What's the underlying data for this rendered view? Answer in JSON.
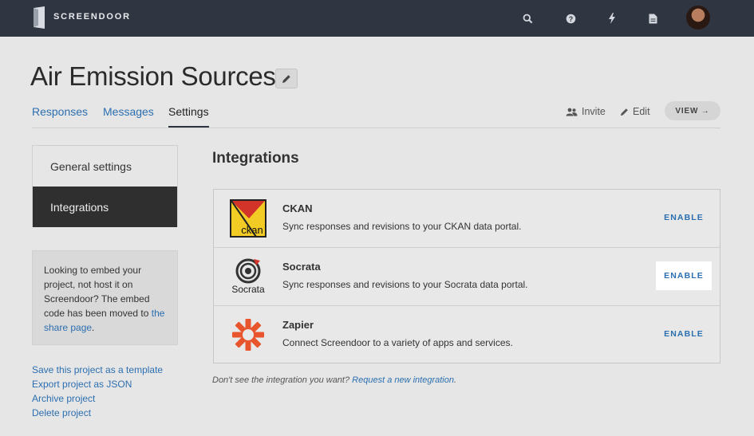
{
  "app": {
    "brand": "SCREENDOOR"
  },
  "topbar": {
    "icons": [
      "search-icon",
      "help-icon",
      "bolt-icon",
      "document-icon"
    ]
  },
  "page": {
    "title": "Air Emission Sources"
  },
  "tabs": [
    {
      "label": "Responses",
      "active": false
    },
    {
      "label": "Messages",
      "active": false
    },
    {
      "label": "Settings",
      "active": true
    }
  ],
  "actions": {
    "invite": "Invite",
    "edit": "Edit",
    "view": "VIEW →"
  },
  "sidebar": {
    "items": [
      {
        "label": "General settings",
        "active": false
      },
      {
        "label": "Integrations",
        "active": true
      }
    ],
    "embed_text": "Looking to embed your project, not host it on Screendoor? The embed code has been moved to",
    "embed_link": "the share page",
    "embed_end": ".",
    "links": [
      "Save this project as a template",
      "Export project as JSON",
      "Archive project",
      "Delete project"
    ]
  },
  "main": {
    "section_title": "Integrations",
    "integrations": [
      {
        "name": "CKAN",
        "description": "Sync responses and revisions to your CKAN data portal.",
        "button": "ENABLE",
        "icon": "ckan-logo",
        "logo_text": "ckan"
      },
      {
        "name": "Socrata",
        "description": "Sync responses and revisions to your Socrata data portal.",
        "button": "ENABLE",
        "icon": "socrata-logo",
        "logo_text": "Socrata"
      },
      {
        "name": "Zapier",
        "description": "Connect Screendoor to a variety of apps and services.",
        "button": "ENABLE",
        "icon": "zapier-logo"
      }
    ],
    "footnote": "Don't see the integration you want?",
    "footnote_link": "Request a new integration",
    "footnote_end": "."
  },
  "colors": {
    "topbar": "#2f3541",
    "link": "#2c6fb0",
    "active_nav": "#2f2f2f"
  }
}
